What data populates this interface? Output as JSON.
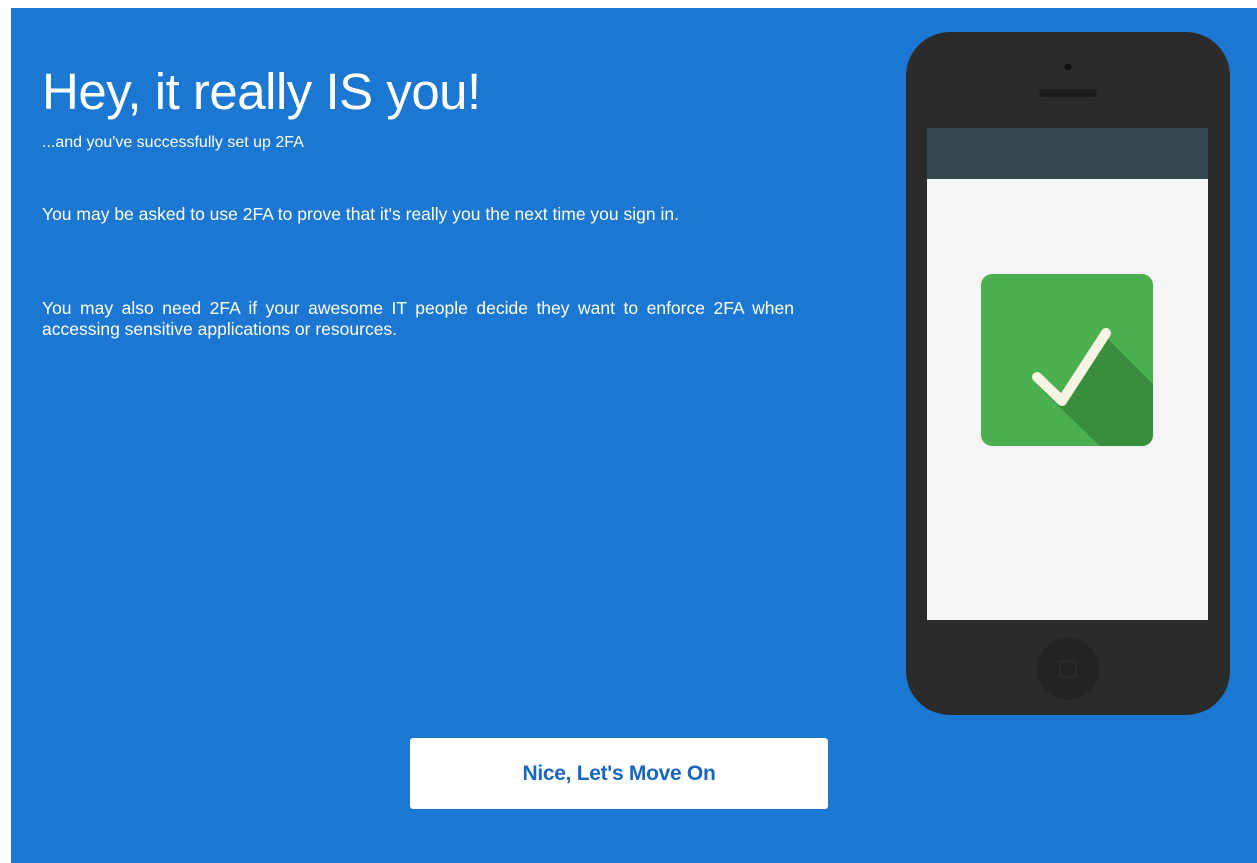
{
  "heading": {
    "title": "Hey, it really IS you!",
    "subtitle": "...and you've successfully set up 2FA"
  },
  "body": {
    "paragraphs": [
      "You may be asked to use 2FA to prove that it's really you the next time you sign in.",
      "You may also need 2FA if your awesome IT people decide they want to enforce 2FA when accessing sensitive applications or resources."
    ]
  },
  "illustration": {
    "device": "smartphone",
    "screen_icon": "checkmark-icon",
    "colors": {
      "background": "#1b77d2",
      "phone_body": "#2b2b2b",
      "status_bar": "#37474f",
      "screen": "#f5f5f5",
      "check_tile": "#4caf50",
      "check_shadow": "#388e3c",
      "check_mark": "#f8f4e3"
    }
  },
  "actions": {
    "continue_label": "Nice, Let's Move On"
  },
  "theme": {
    "accent": "#1b77d2",
    "button_text": "#1b67bd"
  }
}
